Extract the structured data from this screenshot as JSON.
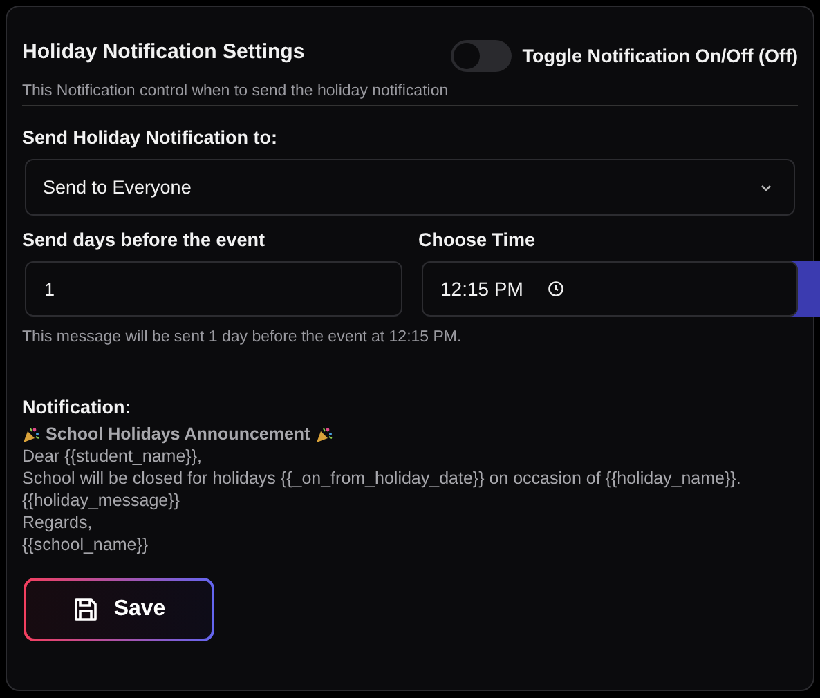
{
  "title": "Holiday Notification Settings",
  "toggle": {
    "label": "Toggle Notification On/Off (Off)",
    "on": false
  },
  "description": "This Notification control when to send the holiday notification",
  "recipient": {
    "label": "Send Holiday Notification to:",
    "value": "Send to Everyone"
  },
  "days": {
    "label": "Send days before the event",
    "value": "1"
  },
  "time": {
    "label": "Choose Time",
    "value": "12:15 PM"
  },
  "helper": "This message will be sent 1 day before the event at 12:15 PM.",
  "notification": {
    "label": "Notification:",
    "heading": "School Holidays Announcement",
    "lines": [
      "Dear {{student_name}},",
      "School will be closed for holidays {{_on_from_holiday_date}} on occasion of {{holiday_name}}.",
      "{{holiday_message}}",
      "Regards,",
      "{{school_name}}"
    ]
  },
  "save_button": "Save"
}
